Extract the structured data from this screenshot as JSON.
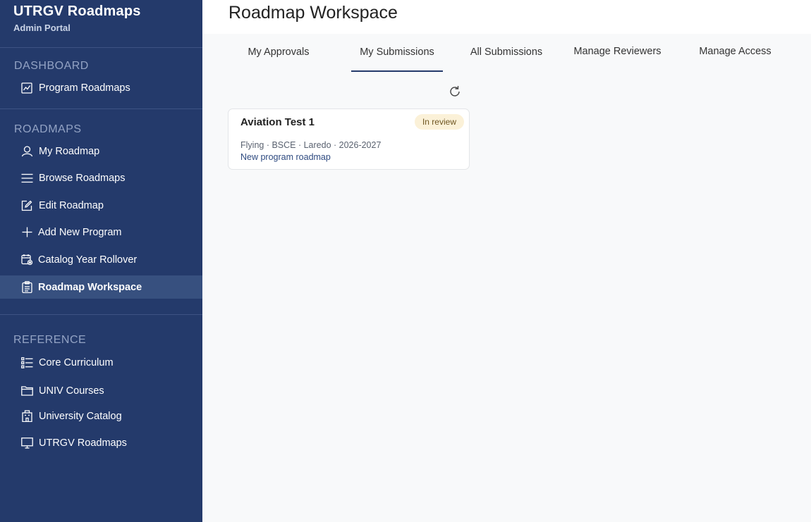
{
  "sidebar": {
    "brand_title": "UTRGV Roadmaps",
    "brand_subtitle": "Admin Portal",
    "sections": {
      "dashboard": "DASHBOARD",
      "roadmaps": "ROADMAPS",
      "reference": "REFERENCE"
    },
    "items": {
      "program_roadmaps": "Program Roadmaps",
      "my_roadmap": "My Roadmap",
      "browse_roadmaps": "Browse Roadmaps",
      "edit_roadmap": "Edit Roadmap",
      "add_new_program": "Add New Program",
      "catalog_year_rollover": "Catalog Year Rollover",
      "roadmap_workspace": "Roadmap Workspace",
      "core_curriculum": "Core Curriculum",
      "univ_courses": "UNIV Courses",
      "university_catalog": "University Catalog",
      "utrgv_roadmaps": "UTRGV Roadmaps"
    },
    "active_item": "roadmap_workspace",
    "colors": {
      "background": "#243a6b",
      "active": "#37507f"
    }
  },
  "main": {
    "title": "Roadmap Workspace",
    "tabs": {
      "my_approvals": "My Approvals",
      "my_submissions": "My Submissions",
      "all_submissions": "All Submissions",
      "manage_reviewers": "Manage Reviewers",
      "manage_access": "Manage Access"
    },
    "active_tab": "my_submissions",
    "refresh_icon": "refresh-icon",
    "cards": [
      {
        "title": "Aviation Test 1",
        "status": "In review",
        "meta": "Flying · BSCE · Laredo · 2026-2027",
        "description": "New program roadmap"
      }
    ]
  }
}
